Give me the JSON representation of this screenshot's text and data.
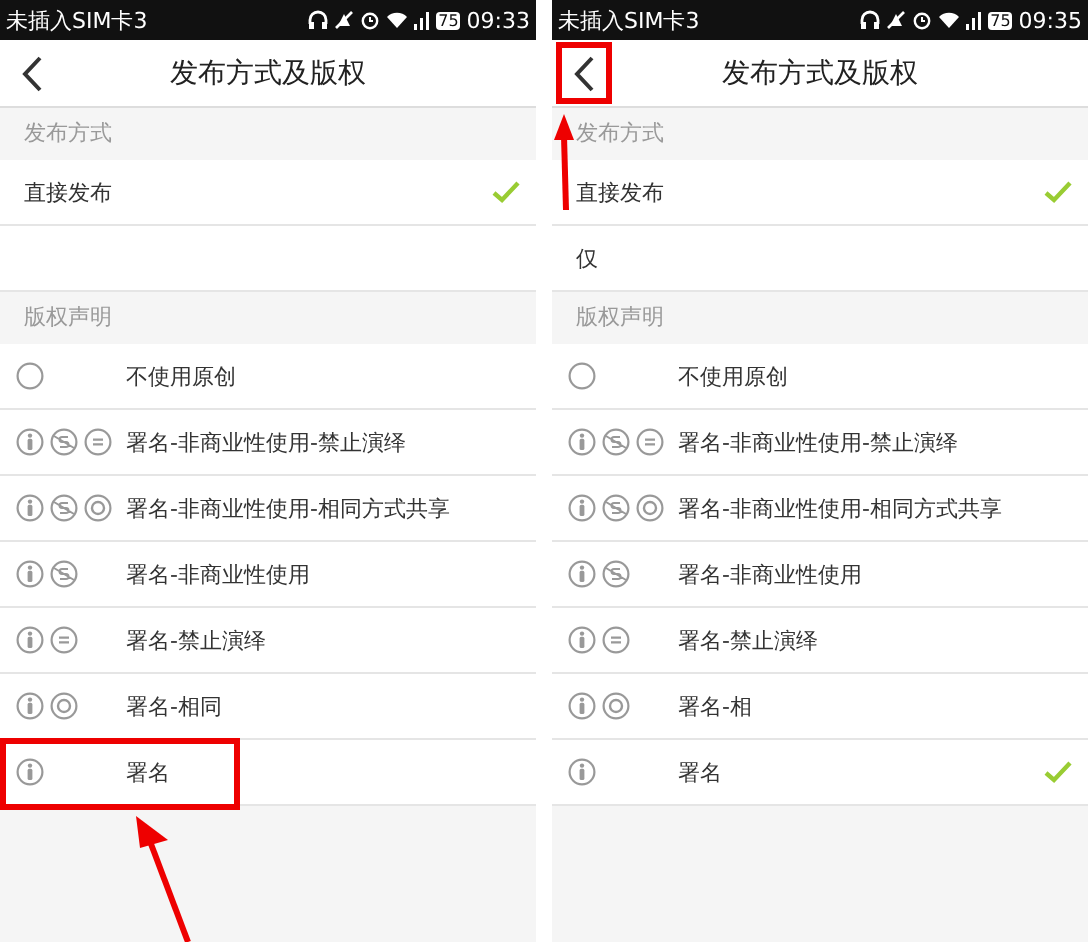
{
  "screens": [
    {
      "status_bar": {
        "carrier": "未插入SIM卡3",
        "battery": "75",
        "time": "09:33"
      },
      "back_button": {
        "highlighted": false
      },
      "title": "发布方式及版权",
      "publish_label": "发布方式",
      "publish_options": [
        {
          "label": "直接发布",
          "selected": true
        }
      ],
      "license_label": "版权声明",
      "licenses": [
        {
          "label": "不使用原创",
          "icons": [
            {
              "kind": "none"
            }
          ],
          "selected": false,
          "highlighted": false
        },
        {
          "label": "署名-非商业性使用-禁止演绎",
          "icons": [
            {
              "kind": "by"
            },
            {
              "kind": "nc"
            },
            {
              "kind": "nd"
            }
          ],
          "selected": false,
          "highlighted": false
        },
        {
          "label": "署名-非商业性使用-相同方式共享",
          "icons": [
            {
              "kind": "by"
            },
            {
              "kind": "nc"
            },
            {
              "kind": "sa"
            }
          ],
          "selected": false,
          "highlighted": false
        },
        {
          "label": "署名-非商业性使用",
          "icons": [
            {
              "kind": "by"
            },
            {
              "kind": "nc"
            }
          ],
          "selected": false,
          "highlighted": false
        },
        {
          "label": "署名-禁止演绎",
          "icons": [
            {
              "kind": "by"
            },
            {
              "kind": "nd"
            }
          ],
          "selected": false,
          "highlighted": false
        },
        {
          "label": "署名-相同",
          "icons": [
            {
              "kind": "by"
            },
            {
              "kind": "sa"
            }
          ],
          "selected": false,
          "highlighted": false
        },
        {
          "label": "署名",
          "icons": [
            {
              "kind": "by"
            }
          ],
          "selected": false,
          "highlighted": true
        }
      ]
    },
    {
      "status_bar": {
        "carrier": "未插入SIM卡3",
        "battery": "75",
        "time": "09:35"
      },
      "back_button": {
        "highlighted": true
      },
      "title": "发布方式及版权",
      "publish_label": "发布方式",
      "publish_options": [
        {
          "label": "直接发布",
          "selected": true
        }
      ],
      "publish_note": "仅",
      "license_label": "版权声明",
      "licenses": [
        {
          "label": "不使用原创",
          "icons": [
            {
              "kind": "none"
            }
          ],
          "selected": false,
          "highlighted": false
        },
        {
          "label": "署名-非商业性使用-禁止演绎",
          "icons": [
            {
              "kind": "by"
            },
            {
              "kind": "nc"
            },
            {
              "kind": "nd"
            }
          ],
          "selected": false,
          "highlighted": false
        },
        {
          "label": "署名-非商业性使用-相同方式共享",
          "icons": [
            {
              "kind": "by"
            },
            {
              "kind": "nc"
            },
            {
              "kind": "sa"
            }
          ],
          "selected": false,
          "highlighted": false
        },
        {
          "label": "署名-非商业性使用",
          "icons": [
            {
              "kind": "by"
            },
            {
              "kind": "nc"
            }
          ],
          "selected": false,
          "highlighted": false
        },
        {
          "label": "署名-禁止演绎",
          "icons": [
            {
              "kind": "by"
            },
            {
              "kind": "nd"
            }
          ],
          "selected": false,
          "highlighted": false
        },
        {
          "label": "署名-相",
          "icons": [
            {
              "kind": "by"
            },
            {
              "kind": "sa"
            }
          ],
          "selected": false,
          "highlighted": false
        },
        {
          "label": "署名",
          "icons": [
            {
              "kind": "by"
            }
          ],
          "selected": true,
          "highlighted": false
        }
      ]
    }
  ]
}
